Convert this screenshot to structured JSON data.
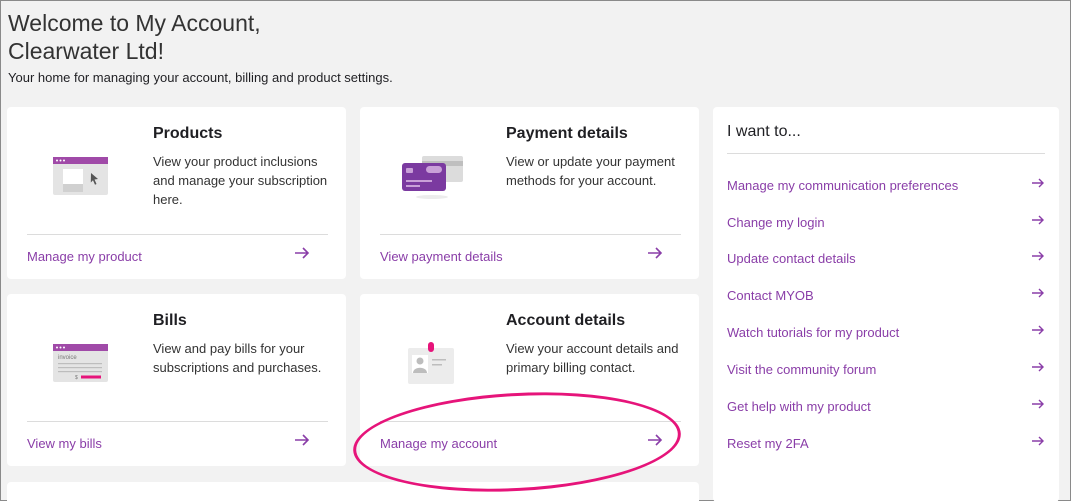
{
  "header": {
    "welcome_line1": "Welcome to My Account,",
    "welcome_line2": "Clearwater Ltd!",
    "subtitle": "Your home for managing your account, billing and product settings."
  },
  "cards": {
    "products": {
      "title": "Products",
      "description": "View your product inclusions and manage your subscription here.",
      "link": "Manage my product"
    },
    "payment": {
      "title": "Payment details",
      "description": "View or update your payment methods for your account.",
      "link": "View payment details"
    },
    "bills": {
      "title": "Bills",
      "description": "View and pay bills for your subscriptions and purchases.",
      "link": "View my bills",
      "illustration_text": "invoice"
    },
    "account": {
      "title": "Account details",
      "description": "View your account details and primary billing contact.",
      "link": "Manage my account"
    }
  },
  "sidebar": {
    "heading": "I want to...",
    "items": [
      "Manage my communication preferences",
      "Change my login",
      "Update contact details",
      "Contact MYOB",
      "Watch tutorials for my product",
      "Visit the community forum",
      "Get help with my product",
      "Reset my 2FA"
    ]
  },
  "colors": {
    "link": "#8a3ea8",
    "accent": "#e6147a",
    "background": "#f2f2f2",
    "card": "#ffffff"
  },
  "icons": {
    "arrow": "arrow-right-icon",
    "products": "browser-window-icon",
    "payment": "credit-card-icon",
    "bills": "invoice-icon",
    "account": "id-badge-icon"
  }
}
